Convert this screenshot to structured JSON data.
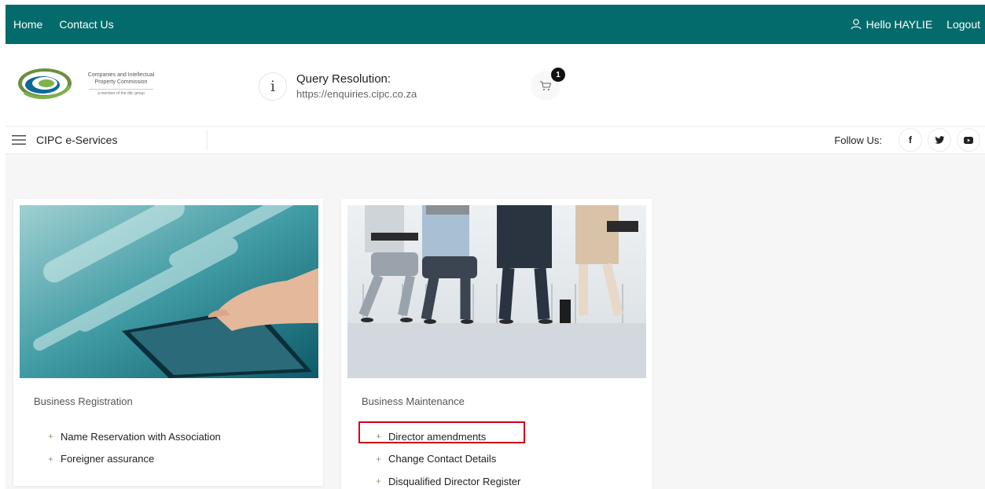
{
  "topbar": {
    "home": "Home",
    "contact": "Contact Us",
    "greeting": "Hello HAYLIE",
    "logout": "Logout",
    "bg_color": "#036b6b"
  },
  "header": {
    "logo_line1": "Companies and Intellectual",
    "logo_line2": "Property Commission",
    "logo_member": "a member of the dtic group",
    "query_title": "Query Resolution:",
    "query_url": "https://enquiries.cipc.co.za",
    "cart_count": "1",
    "info_glyph": "i"
  },
  "nav": {
    "title": "CIPC e-Services",
    "follow_label": "Follow Us:",
    "facebook": "f",
    "twitter": "t",
    "youtube": "▶"
  },
  "cards": [
    {
      "title": "Business Registration",
      "items": [
        "Name Reservation with Association",
        "Foreigner assurance"
      ]
    },
    {
      "title": "Business Maintenance",
      "items": [
        "Director amendments",
        "Change Contact Details",
        "Disqualified Director Register"
      ]
    }
  ],
  "highlight_color": "#d0021b"
}
